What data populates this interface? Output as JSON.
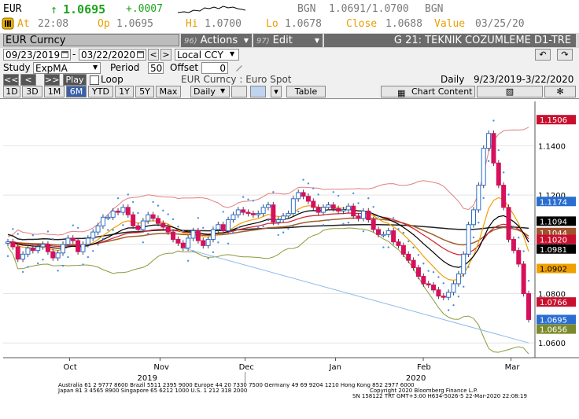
{
  "quote": {
    "ticker": "EUR",
    "arrow": "↑",
    "last": "1.0695",
    "change": "+.0007",
    "source": "BGN",
    "bid_ask": "1.0691/1.0700",
    "source2": "BGN",
    "at_label": "At",
    "at_time": "22:08",
    "op_label": "Op",
    "op_value": "1.0695",
    "hi_label": "Hi",
    "hi_value": "1.0700",
    "lo_label": "Lo",
    "lo_value": "1.0678",
    "close_label": "Close",
    "close_value": "1.0688",
    "value_label": "Value",
    "value_date": "03/25/20"
  },
  "toolbar": {
    "security": "EUR Curncy",
    "actions_num": "96)",
    "actions_label": "Actions",
    "edit_num": "97)",
    "edit_label": "Edit",
    "title": "G 21: TEKNIK COZUMLEME D1-TRE"
  },
  "dates": {
    "start": "09/23/2019",
    "end": "03/22/2020",
    "currency": "Local CCY",
    "prev": "<",
    "next": ">",
    "undo": "↶",
    "redo": "↷"
  },
  "study": {
    "label": "Study",
    "value": "ExpMA",
    "period_label": "Period",
    "period_value": "50",
    "offset_label": "Offset",
    "offset_value": "0"
  },
  "playback": {
    "rewind": "<<",
    "back": "<",
    "forward": ">>",
    "play": "Play",
    "loop": "Loop",
    "security_desc": "EUR Curncy : Euro Spot",
    "frequency": "Daily",
    "range": "9/23/2019-3/22/2020"
  },
  "periods": {
    "buttons": [
      "1D",
      "3D",
      "1M",
      "6M",
      "YTD",
      "1Y",
      "5Y",
      "Max"
    ],
    "active": "6M",
    "frequency": "Daily",
    "table_label": "Table",
    "chart_content_label": "Chart Content"
  },
  "chart_data": {
    "type": "candlestick",
    "y_ticks": [
      "1.1400",
      "1.1200",
      "1.1000",
      "1.0800",
      "1.0600"
    ],
    "ylim": [
      1.054,
      1.158
    ],
    "x_ticks": [
      "Oct",
      "Nov",
      "Dec",
      "Jan",
      "Feb",
      "Mar"
    ],
    "years": [
      "2019",
      "2020"
    ],
    "price_labels": [
      {
        "value": "1.1506",
        "color": "#c8102e"
      },
      {
        "value": "1.1174",
        "color": "#2a6dd0"
      },
      {
        "value": "1.1094",
        "color": "#000000"
      },
      {
        "value": "1.1044",
        "color": "#a0522d"
      },
      {
        "value": "1.1020",
        "color": "#c8102e"
      },
      {
        "value": "1.0981",
        "color": "#000000"
      },
      {
        "value": "1.0902",
        "color": "#f0a000"
      },
      {
        "value": "1.0766",
        "color": "#c8102e"
      },
      {
        "value": "1.0695",
        "color": "#2a6dd0"
      },
      {
        "value": "1.0656",
        "color": "#7a8a2a"
      }
    ],
    "closes": [
      1.101,
      1.099,
      1.094,
      1.096,
      1.0985,
      1.0975,
      1.099,
      1.1,
      1.097,
      1.0945,
      1.0965,
      1.1,
      1.1025,
      1.1015,
      1.097,
      1.1,
      1.1025,
      1.105,
      1.1075,
      1.111,
      1.111,
      1.1135,
      1.113,
      1.115,
      1.112,
      1.1075,
      1.106,
      1.1095,
      1.112,
      1.1105,
      1.1085,
      1.107,
      1.105,
      1.102,
      1.1005,
      1.0985,
      1.1025,
      1.1055,
      1.1015,
      1.0995,
      1.102,
      1.106,
      1.108,
      1.1055,
      1.11,
      1.112,
      1.114,
      1.113,
      1.1125,
      1.112,
      1.1125,
      1.115,
      1.116,
      1.109,
      1.11,
      1.1115,
      1.1125,
      1.1185,
      1.121,
      1.1195,
      1.1175,
      1.115,
      1.113,
      1.115,
      1.116,
      1.1145,
      1.1135,
      1.114,
      1.1155,
      1.1115,
      1.1105,
      1.1135,
      1.11,
      1.106,
      1.104,
      1.104,
      1.1055,
      1.101,
      1.0995,
      1.096,
      1.0935,
      1.0905,
      1.087,
      1.084,
      1.0835,
      1.0815,
      1.079,
      1.0785,
      1.0805,
      1.084,
      1.088,
      1.096,
      1.108,
      1.114,
      1.124,
      1.139,
      1.145,
      1.133,
      1.124,
      1.115,
      1.102,
      1.0975,
      1.092,
      1.08,
      1.0695
    ],
    "bottom_ticker": "Australia 61 2 9777 8600 Brazil 5511 2395 9000 Europe 44 20 7330 7500 Germany 49 69 9204 1210 Hong Kong 852 2977 6000",
    "bottom_ticker2": "Japan 81 3 4565 8900     Singapore 65 6212 1000     U.S. 1 212 318 2000",
    "copyright": "Copyright 2020 Bloomberg Finance L.P.",
    "footer_id": "SN 158122 TRT  GMT+3:00 H634-5026-5 22-Mar-2020 22:08:19"
  }
}
